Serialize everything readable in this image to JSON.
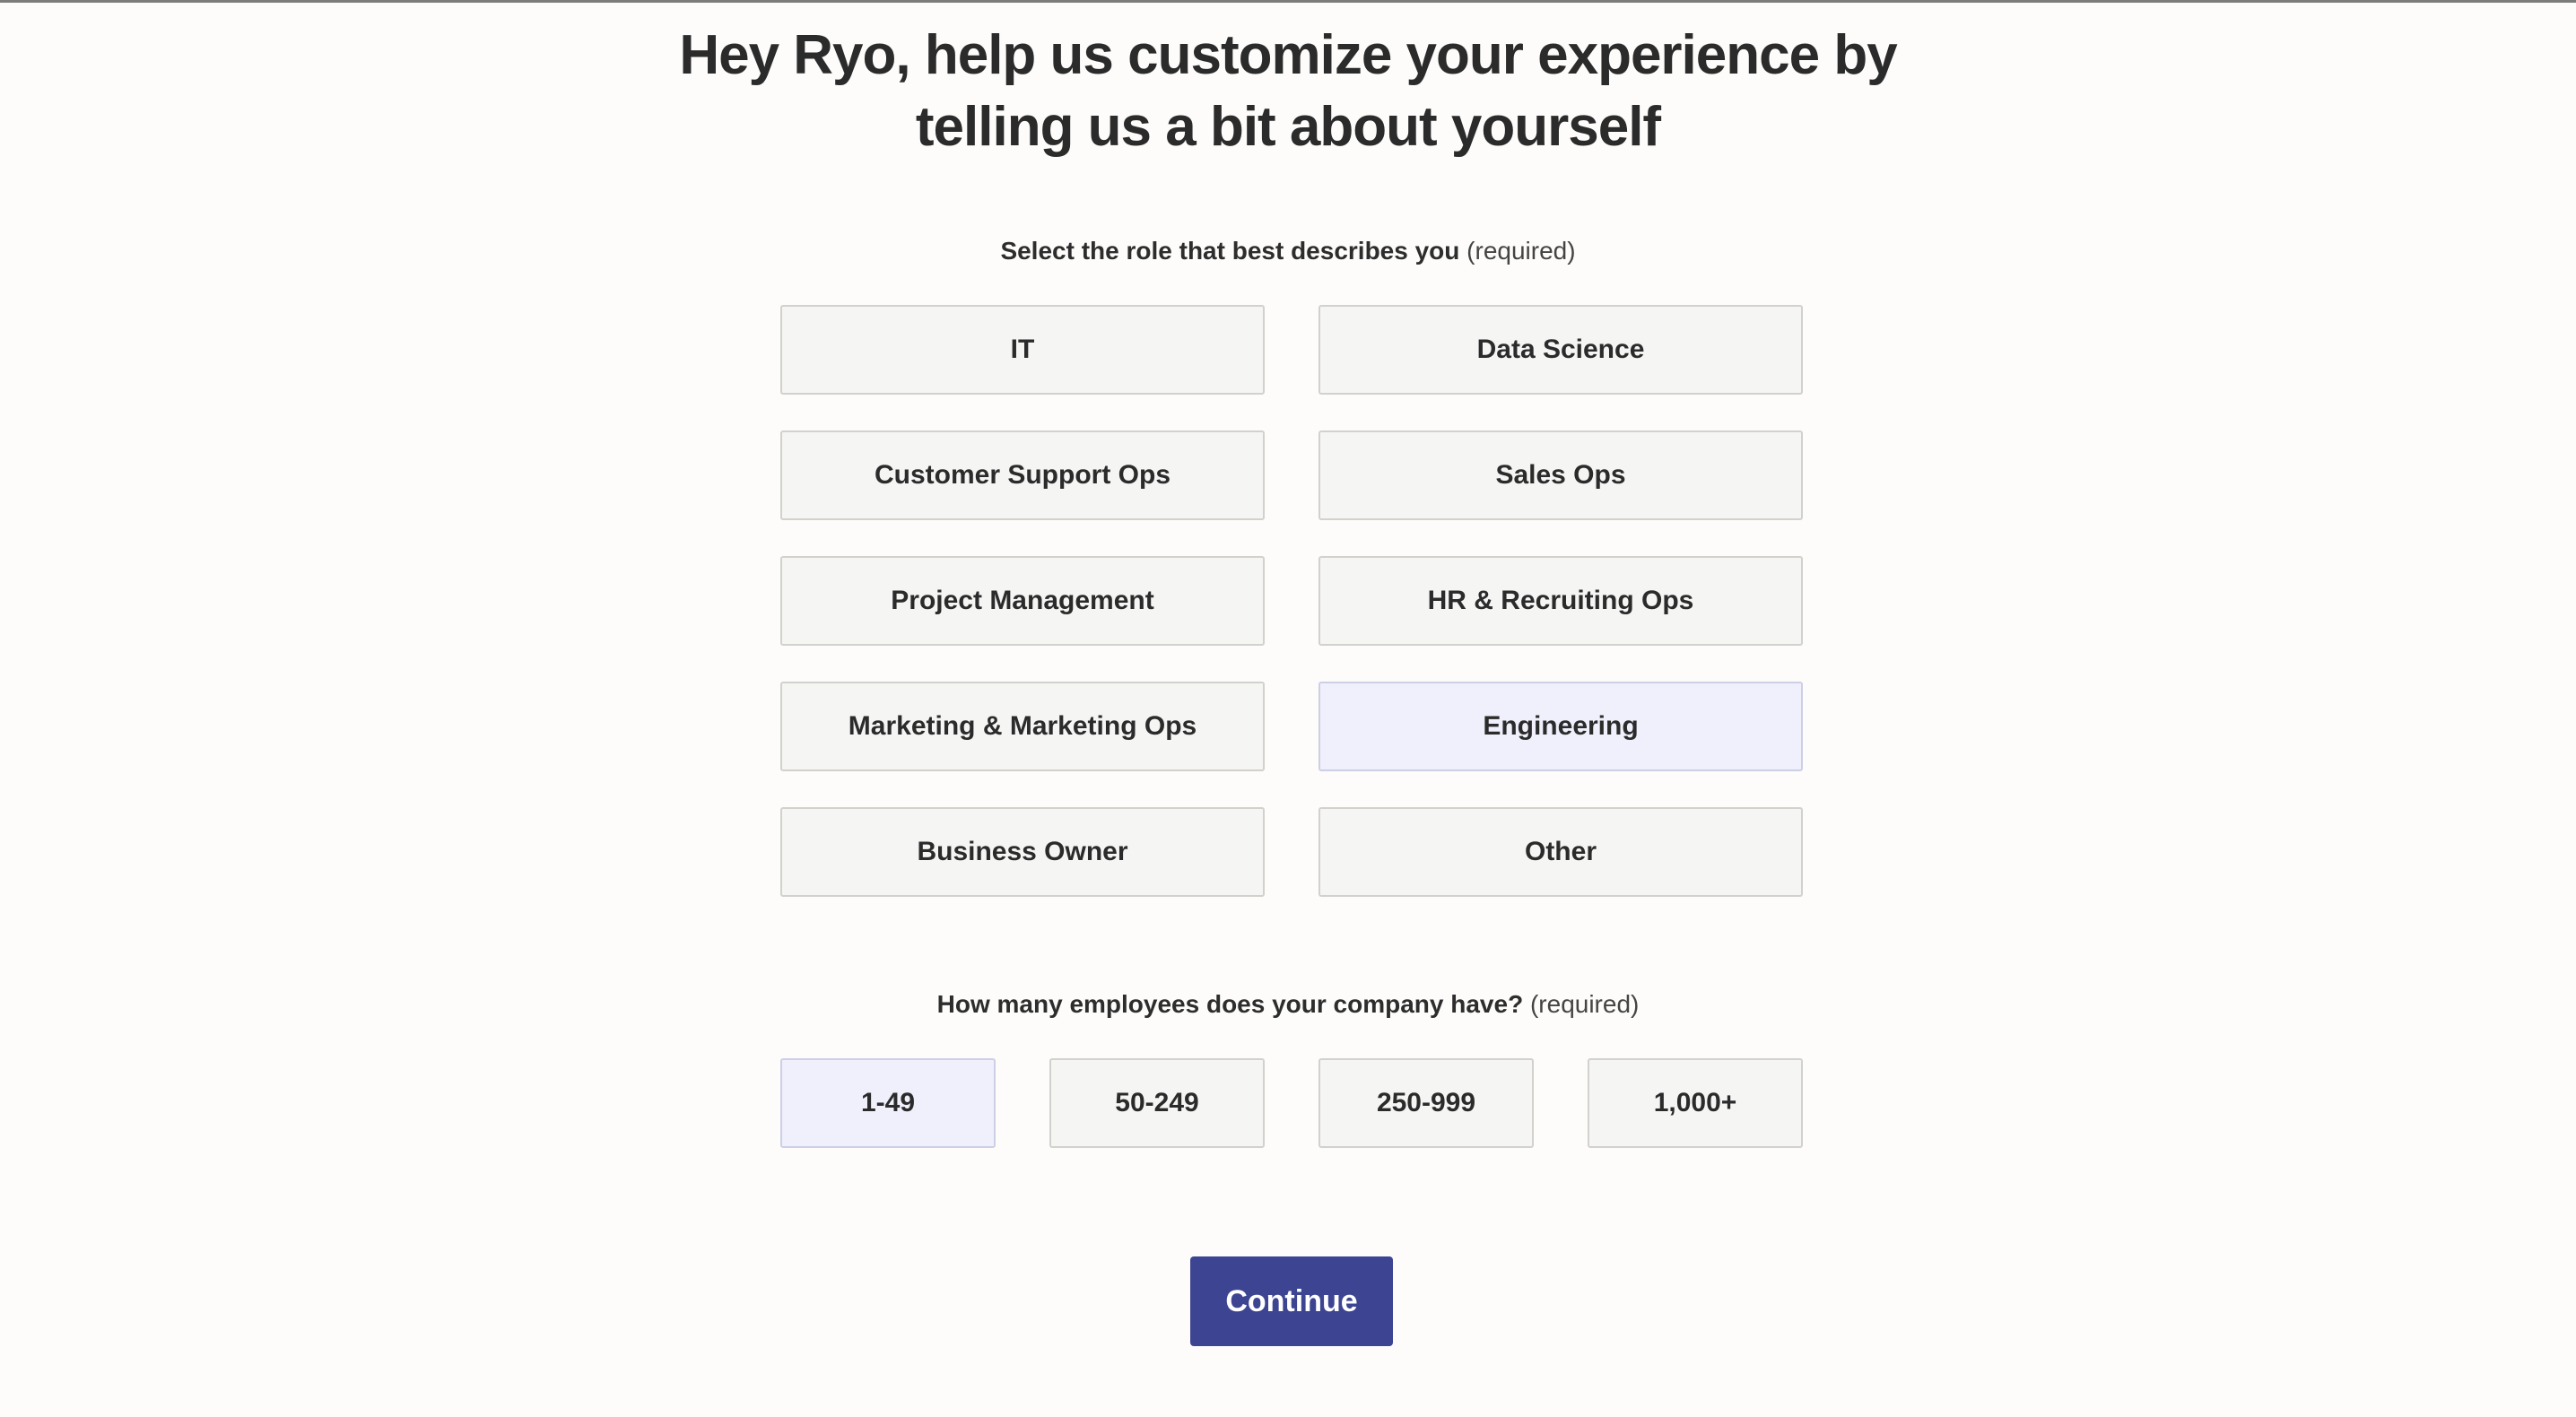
{
  "headline": {
    "line1": "Hey Ryo, help us customize your experience by",
    "line2": "telling us a bit about yourself"
  },
  "role_question": {
    "text": "Select the role that best describes you",
    "required": "(required)"
  },
  "roles": [
    {
      "label": "IT",
      "selected": false
    },
    {
      "label": "Data Science",
      "selected": false
    },
    {
      "label": "Customer Support Ops",
      "selected": false
    },
    {
      "label": "Sales Ops",
      "selected": false
    },
    {
      "label": "Project Management",
      "selected": false
    },
    {
      "label": "HR & Recruiting Ops",
      "selected": false
    },
    {
      "label": "Marketing & Marketing Ops",
      "selected": false
    },
    {
      "label": "Engineering",
      "selected": true
    },
    {
      "label": "Business Owner",
      "selected": false
    },
    {
      "label": "Other",
      "selected": false
    }
  ],
  "employees_question": {
    "text": "How many employees does your company have?",
    "required": "(required)"
  },
  "employee_sizes": [
    {
      "label": "1-49",
      "selected": true
    },
    {
      "label": "50-249",
      "selected": false
    },
    {
      "label": "250-999",
      "selected": false
    },
    {
      "label": "1,000+",
      "selected": false
    }
  ],
  "continue_label": "Continue",
  "colors": {
    "background": "#fdfcfa",
    "option_background": "#f5f5f4",
    "selected_background": "#eff0fb",
    "primary_button": "#3d4592"
  }
}
